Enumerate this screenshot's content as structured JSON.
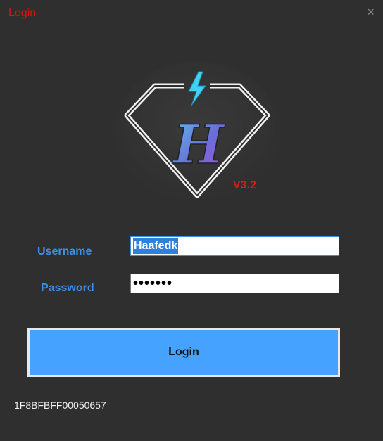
{
  "window": {
    "title": "Login",
    "close_glyph": "×"
  },
  "logo": {
    "letter": "H",
    "version": "V3.2",
    "icon": "diamond-lightning-logo"
  },
  "form": {
    "username_label": "Username",
    "username_value": "Haafedk",
    "password_label": "Password",
    "password_value": "•••••••"
  },
  "login_button": "Login",
  "hwid": "1F8BFBFF00050657",
  "colors": {
    "title": "#e01010",
    "label": "#3d8fe8",
    "button": "#45a2ff",
    "version": "#e01818"
  }
}
